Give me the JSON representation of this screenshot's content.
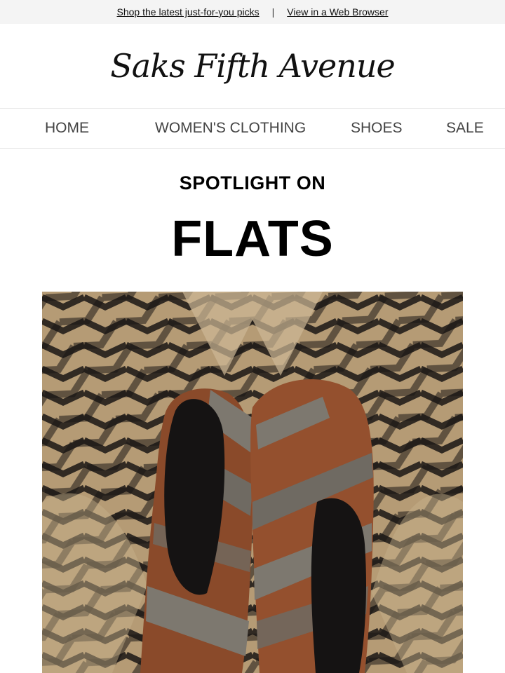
{
  "topbar": {
    "link_picks": "Shop the latest just-for-you picks",
    "separator": "|",
    "link_browser": "View in a Web Browser"
  },
  "brand": {
    "logo_text": "Saks Fifth Avenue"
  },
  "nav": {
    "items": [
      {
        "label": "HOME"
      },
      {
        "label": "WOMEN'S CLOTHING"
      },
      {
        "label": "SHOES"
      },
      {
        "label": "SALE"
      }
    ]
  },
  "hero": {
    "kicker": "SPOTLIGHT ON",
    "headline": "FLATS"
  },
  "colors": {
    "topbar_bg": "#f4f4f4",
    "rug_beige": "#b59b75",
    "rug_stripe": "#1a1614",
    "suede_brown": "#8a4a2a",
    "leather_grey": "#7d786f"
  }
}
